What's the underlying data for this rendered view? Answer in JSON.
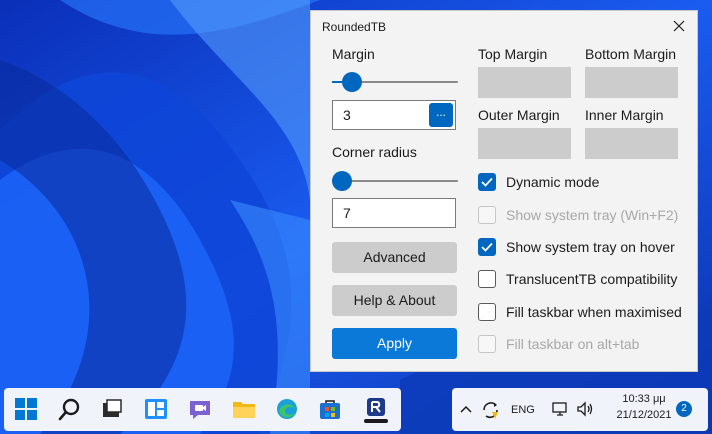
{
  "window": {
    "title": "RoundedTB",
    "close_label": "close"
  },
  "margin": {
    "label": "Margin",
    "slider_value": 0.16,
    "value": "3",
    "browse_label": "..."
  },
  "corner_radius": {
    "label": "Corner radius",
    "slider_value": 0.08,
    "value": "7"
  },
  "margins": {
    "top": "Top Margin",
    "bottom": "Bottom Margin",
    "outer": "Outer Margin",
    "inner": "Inner Margin"
  },
  "buttons": {
    "advanced": "Advanced",
    "help": "Help & About",
    "apply": "Apply"
  },
  "options": [
    {
      "label": "Dynamic mode",
      "checked": true,
      "disabled": false
    },
    {
      "label": "Show system tray (Win+F2)",
      "checked": false,
      "disabled": true
    },
    {
      "label": "Show system tray on hover",
      "checked": true,
      "disabled": false
    },
    {
      "label": "TranslucentTB compatibility",
      "checked": false,
      "disabled": false
    },
    {
      "label": "Fill taskbar when maximised",
      "checked": false,
      "disabled": false
    },
    {
      "label": "Fill taskbar on alt+tab",
      "checked": false,
      "disabled": true
    }
  ],
  "taskbar": {
    "icons": [
      "windows-start-icon",
      "search-icon",
      "task-view-icon",
      "widgets-icon",
      "chat-icon",
      "file-explorer-icon",
      "edge-icon",
      "store-icon",
      "roundedtb-icon"
    ]
  },
  "tray": {
    "language": "ENG",
    "time": "10:33 μμ",
    "date": "21/12/2021",
    "notifications": "2"
  },
  "colors": {
    "accent": "#0067c0",
    "apply": "#0a79d8",
    "wallpaper": "#0b3fd6"
  }
}
